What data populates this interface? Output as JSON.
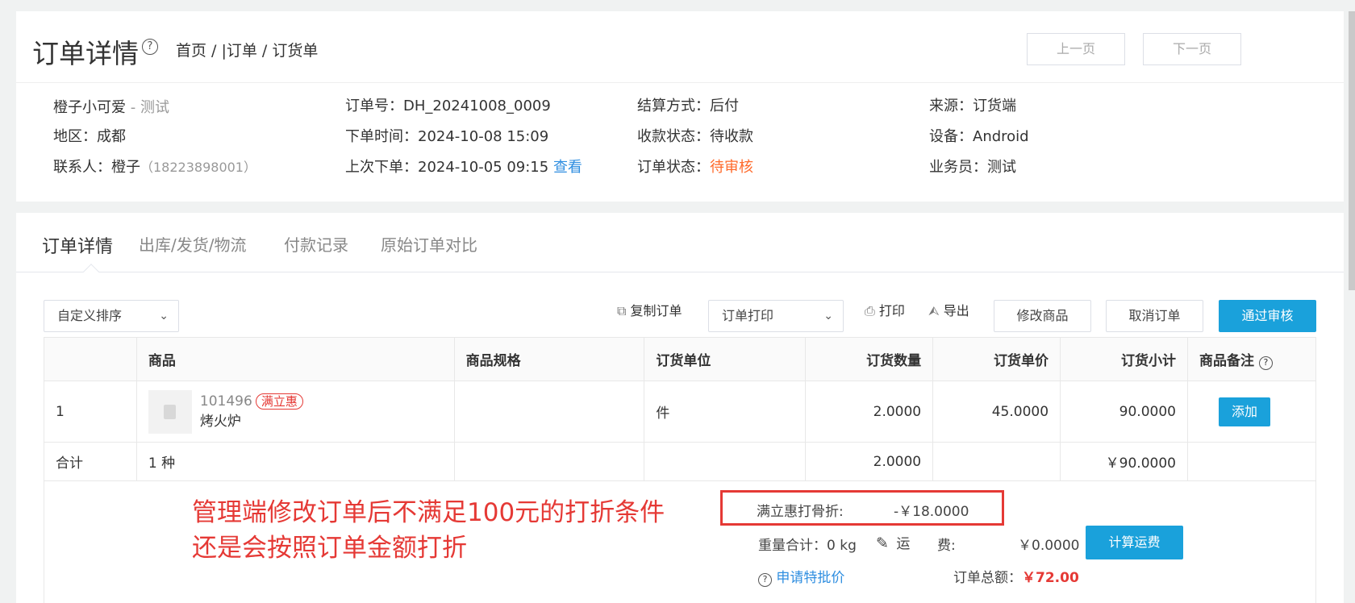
{
  "header": {
    "title": "订单详情",
    "help": "?",
    "breadcrumb": "首页 / |订单 / 订货单",
    "prev_label": "上一页",
    "next_label": "下一页"
  },
  "info": {
    "customer_name": "橙子小可爱",
    "customer_sep": " - ",
    "customer_tag": "测试",
    "region": "地区：成都",
    "contact": "联系人：橙子",
    "contact_phone": "（18223898001）",
    "order_no": "订单号：DH_20241008_0009",
    "order_time": "下单时间：2024-10-08 15:09",
    "last_order": "上次下单：2024-10-05 09:15",
    "last_order_link": "查看",
    "settle": "结算方式：后付",
    "pay_status": "收款状态：待收款",
    "order_status_label": "订单状态：",
    "order_status": "待审核",
    "source": "来源：订货端",
    "device": "设备：Android",
    "salesman": "业务员：测试"
  },
  "tabs": [
    "订单详情",
    "出库/发货/物流",
    "付款记录",
    "原始订单对比"
  ],
  "toolbar": {
    "sort_select": "自定义排序",
    "copy_order": "复制订单",
    "print_select": "订单打印",
    "print": "打印",
    "export": "导出",
    "edit_goods": "修改商品",
    "cancel_order": "取消订单",
    "approve": "通过审核"
  },
  "table": {
    "columns": [
      "",
      "商品",
      "商品规格",
      "订货单位",
      "订货数量",
      "订货单价",
      "订货小计",
      "商品备注"
    ],
    "rows": [
      {
        "index": "1",
        "code": "101496",
        "promo": "满立惠",
        "name": "烤火炉",
        "spec": "",
        "unit": "件",
        "qty": "2.0000",
        "price": "45.0000",
        "subtotal": "90.0000",
        "note_action": "添加"
      }
    ],
    "total": {
      "label": "合计",
      "kinds": "1 种",
      "qty": "2.0000",
      "subtotal": "￥90.0000"
    }
  },
  "annotation": {
    "line1": "管理端修改订单后不满足100元的打折条件",
    "line2": "还是会按照订单金额打折"
  },
  "summary": {
    "discount_label": "满立惠打骨折:",
    "discount_value": "-￥18.0000",
    "weight": "重量合计：0 kg",
    "freight_a": "运",
    "freight_b": "费:",
    "freight_value": "￥0.0000",
    "calc_freight": "计算运费",
    "special_price": "申请特批价",
    "total_label": "订单总额：",
    "total_currency": "￥",
    "total_value": "72.00"
  }
}
